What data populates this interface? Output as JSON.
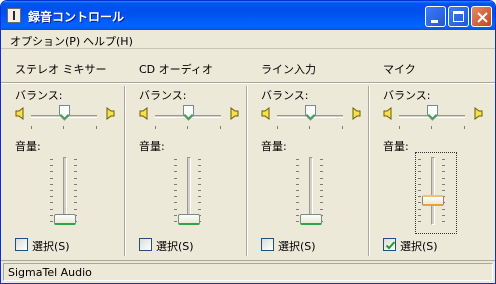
{
  "window": {
    "title": "録音コントロール"
  },
  "menu": {
    "options": "オプション(P)",
    "help": "ヘルプ(H)"
  },
  "panels": [
    {
      "title": "ステレオ ミキサー",
      "balance_label": "バランス:",
      "volume_label": "音量:",
      "select_label": "選択(S)",
      "selected": false,
      "balance_value": 0.5,
      "volume_value": 0.0
    },
    {
      "title": "CD オーディオ",
      "balance_label": "バランス:",
      "volume_label": "音量:",
      "select_label": "選択(S)",
      "selected": false,
      "balance_value": 0.5,
      "volume_value": 0.0
    },
    {
      "title": "ライン入力",
      "balance_label": "バランス:",
      "volume_label": "音量:",
      "select_label": "選択(S)",
      "selected": false,
      "balance_value": 0.5,
      "volume_value": 0.0
    },
    {
      "title": "マイク",
      "balance_label": "バランス:",
      "volume_label": "音量:",
      "select_label": "選択(S)",
      "selected": true,
      "balance_value": 0.5,
      "volume_value": 0.3
    }
  ],
  "status": {
    "device": "SigmaTel Audio"
  },
  "colors": {
    "titlebar": "#0053ee",
    "window_bg": "#ece9d8",
    "thumb_green": "#2ea546",
    "thumb_orange": "#f0a028",
    "check_green": "#21a121"
  }
}
